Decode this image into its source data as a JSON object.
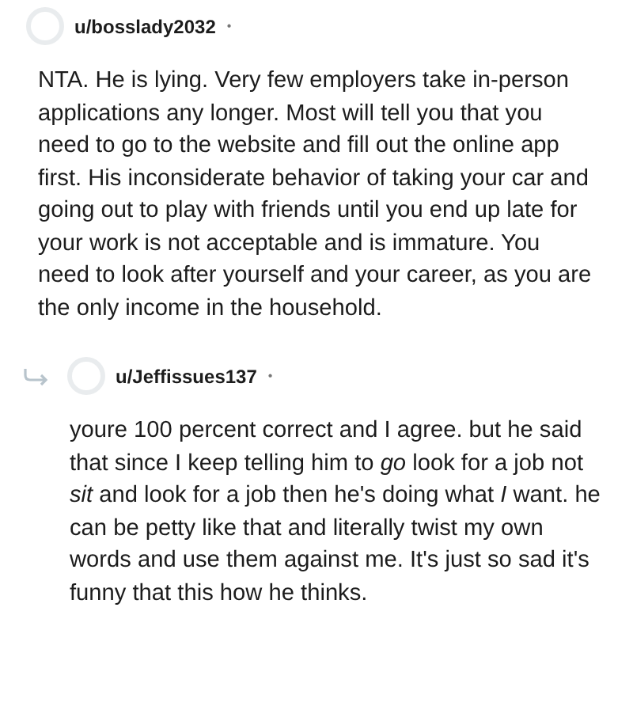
{
  "comments": [
    {
      "username": "u/bosslady2032",
      "separator": "•",
      "body": "NTA. He is lying. Very few employers take in-person applications any longer. Most will tell you that you need to go to the website and fill out the online app first. His inconsiderate behavior of taking your car and going out to play with friends until you end up late for your work is not acceptable and is immature. You need to look after yourself and your career, as you are the only income in the household.",
      "kind": "top"
    },
    {
      "username": "u/Jeffissues137",
      "separator": "•",
      "body": "youre 100 percent correct and I agree. but he said that since I keep telling him to *go* look for a job not *sit* and look for a job then he's doing what *I* want. he can be petty like that and literally twist my own words and use them against me. It's just so sad it's funny that this how he thinks.",
      "kind": "reply"
    }
  ]
}
